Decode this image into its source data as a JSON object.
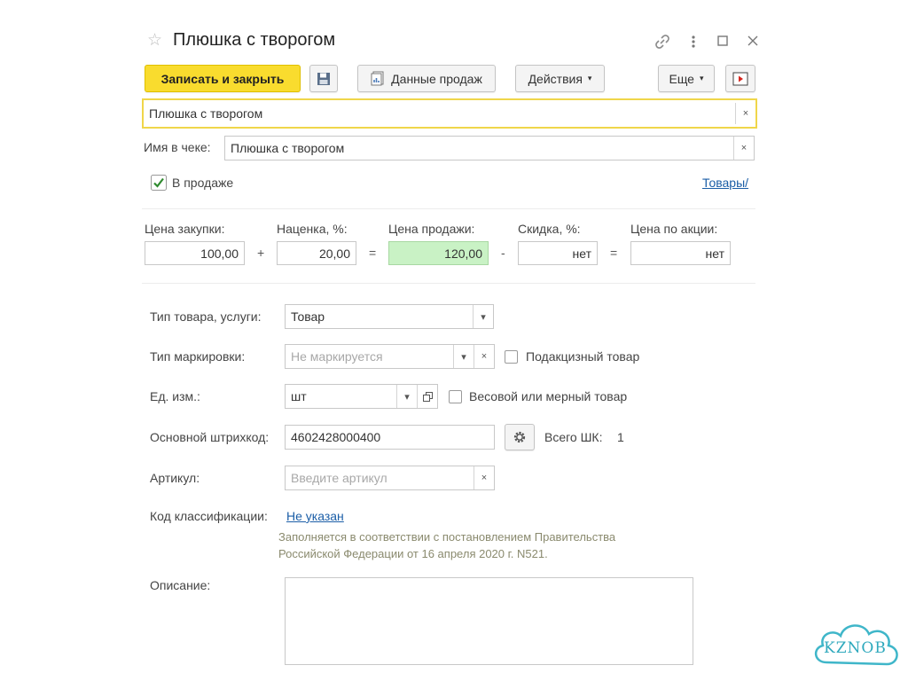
{
  "window": {
    "title": "Плюшка с творогом"
  },
  "toolbar": {
    "save_close": "Записать и закрыть",
    "sales_data": "Данные продаж",
    "actions": "Действия",
    "more": "Еще"
  },
  "name_field": {
    "value": "Плюшка с творогом"
  },
  "receipt": {
    "label": "Имя в чеке:",
    "value": "Плюшка с творогом"
  },
  "on_sale": {
    "label": "В продаже",
    "checked": true
  },
  "goods_link": "Товары/",
  "prices": {
    "purchase_label": "Цена закупки:",
    "purchase_value": "100,00",
    "plus": "+",
    "markup_label": "Наценка, %:",
    "markup_value": "20,00",
    "equals": "=",
    "sale_label": "Цена продажи:",
    "sale_value": "120,00",
    "minus": "-",
    "discount_label": "Скидка, %:",
    "discount_value": "нет",
    "equals2": "=",
    "promo_label": "Цена по акции:",
    "promo_value": "нет"
  },
  "type": {
    "label": "Тип товара, услуги:",
    "value": "Товар"
  },
  "marking": {
    "label": "Тип маркировки:",
    "placeholder": "Не маркируется",
    "excise_label": "Подакцизный товар"
  },
  "unit": {
    "label": "Ед. изм.:",
    "value": "шт",
    "weighted_label": "Весовой или мерный товар"
  },
  "barcode": {
    "label": "Основной штрихкод:",
    "value": "4602428000400",
    "total_label": "Всего ШК:",
    "total_value": "1"
  },
  "article": {
    "label": "Артикул:",
    "placeholder": "Введите артикул"
  },
  "classification": {
    "label": "Код классификации:",
    "link": "Не указан",
    "note_line1": "Заполняется в соответствии с постановлением Правительства",
    "note_line2": "Российской Федерации от 16 апреля 2020 г. N521."
  },
  "description": {
    "label": "Описание:"
  },
  "watermark": {
    "text": "KZNOB"
  },
  "colors": {
    "accent_yellow": "#f9dc2e",
    "sale_price_bg": "#c9f2c5",
    "link_blue": "#1b5ea7"
  }
}
